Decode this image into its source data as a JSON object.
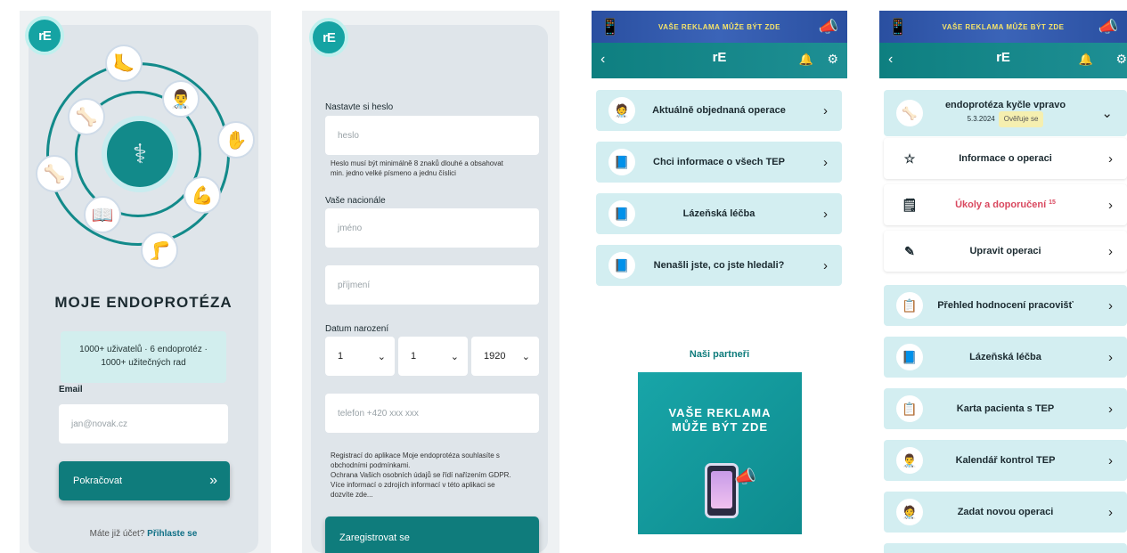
{
  "s1": {
    "logo": "rE",
    "app_title": "MOJE ENDOPROTÉZA",
    "stats_line1": "1000+ uživatelů · 6 endoprotéz ·",
    "stats_line2": "1000+ užitečných rad",
    "email_label": "Email",
    "email_placeholder": "jan@novak.cz",
    "continue_button": "Pokračovat",
    "continue_arrow": "»",
    "login_prompt": "Máte již účet?",
    "login_link": "Přihlaste se"
  },
  "s2": {
    "logo": "rE",
    "password_label": "Nastavte si heslo",
    "password_placeholder": "heslo",
    "password_hint_line1": "Heslo musí být minimálně 8 znaků dlouhé a obsahovat",
    "password_hint_line2": "min. jedno velké písmeno a jednu číslici",
    "name_label": "Vaše nacionále",
    "first_name_placeholder": "jméno",
    "last_name_placeholder": "příjmení",
    "dob_label": "Datum narození",
    "dob_day": "1",
    "dob_month": "1",
    "dob_year": "1920",
    "phone_placeholder": "telefon +420 xxx xxx",
    "terms_line1": "Registrací do aplikace Moje endoprotéza souhlasíte s",
    "terms_line2": "obchodními podmínkami.",
    "terms_line3": "Ochrana Vašich osobních údajů se řídí nařízením GDPR.",
    "terms_line4": "Více informací o zdrojích informací v této aplikaci se",
    "terms_line5": "dozvíte zde...",
    "register_button": "Zaregistrovat se"
  },
  "s3": {
    "ad_banner": "VAŠE REKLAMA MŮŽE BÝT ZDE",
    "nav_logo": "rE",
    "menu": [
      {
        "label": "Aktuálně objednaná operace",
        "icon": "surgeon-icon"
      },
      {
        "label": "Chci informace o všech TEP",
        "icon": "book-icon"
      },
      {
        "label": "Lázeňská léčba",
        "icon": "book-icon"
      },
      {
        "label": "Nenašli jste, co jste hledali?",
        "icon": "book-icon"
      }
    ],
    "partners_title": "Naši partneři",
    "ad_box_line1": "VAŠE REKLAMA",
    "ad_box_line2": "MŮŽE BÝT ZDE"
  },
  "s4": {
    "ad_banner": "VAŠE REKLAMA MŮŽE BÝT ZDE",
    "nav_logo": "rE",
    "operation_title": "endoprotéza kyčle vpravo",
    "operation_date": "5.3.2024",
    "verify_badge": "Ověřuje se",
    "menu": [
      {
        "label": "Informace o operaci",
        "icon": "star-icon"
      },
      {
        "label": "Úkoly a doporučení",
        "icon": "task-icon",
        "count": "15"
      },
      {
        "label": "Upravit operaci",
        "icon": "pencil-icon"
      },
      {
        "label": "Přehled hodnocení pracovišť",
        "icon": "list-icon"
      },
      {
        "label": "Lázeňská léčba",
        "icon": "book-icon"
      },
      {
        "label": "Karta pacienta s TEP",
        "icon": "clipboard-icon"
      },
      {
        "label": "Kalendář kontrol TEP",
        "icon": "doctor-icon"
      },
      {
        "label": "Zadat novou operaci",
        "icon": "surgeon-icon"
      }
    ]
  }
}
